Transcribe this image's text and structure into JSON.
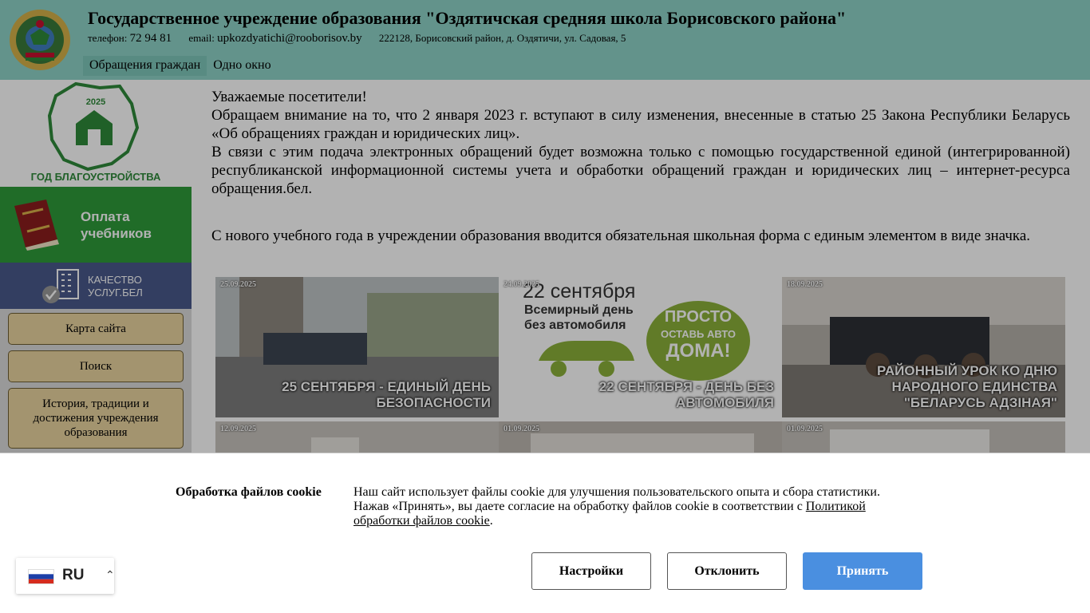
{
  "header": {
    "school_name": "Государственное учреждение образования \"Оздятичская средняя школа Борисовского района\"",
    "phone_label": "телефон:",
    "phone": "72 94 81",
    "email_label": "email:",
    "email": "upkozdyatichi@rooborisov.by",
    "address": "222128, Борисовский район, д. Оздятичи, ул. Садовая, 5",
    "nav": [
      {
        "label": "Обращения граждан"
      },
      {
        "label": "Одно окно"
      }
    ]
  },
  "sidebar": {
    "year_logo": {
      "year": "2025",
      "caption": "ГОД БЛАГОУСТРОЙСТВА"
    },
    "pay_label": "Оплата учебников",
    "quality_line1": "КАЧЕСТВО",
    "quality_line2": "УСЛУГ.БЕЛ",
    "menu": [
      {
        "label": "Карта сайта"
      },
      {
        "label": "Поиск"
      },
      {
        "label": "История, традиции и достижения учреждения образования"
      }
    ]
  },
  "main": {
    "notice": {
      "greeting": "Уважаемые посетители!",
      "p1": "Обращаем внимание на то, что 2 января 2023 г. вступают в силу изменения, внесенные в статью 25 Закона Республики Беларусь «Об обращениях граждан и юридических лиц».",
      "p2": "В связи с этим подача электронных обращений будет возможна только с помощью государственной единой (интегрированной) республиканской информационной системы учета и обработки обращений граждан и юридических лиц – интернет-ресурса обращения.бел.",
      "p3": "С нового учебного года в учреждении образования вводится обязательная школьная форма с единым элементом в виде значка."
    },
    "news": [
      {
        "date": "25.09.2025",
        "title": "25 СЕНТЯБРЯ - ЕДИНЫЙ ДЕНЬ БЕЗОПАСНОСТИ"
      },
      {
        "date": "24.09.2025",
        "title": "22 СЕНТЯБРЯ - ДЕНЬ БЕЗ АВТОМОБИЛЯ",
        "poster": {
          "line1": "22 сентября",
          "line2": "Всемирный день",
          "line3": "без автомобиля",
          "cloud1": "ПРОСТО",
          "cloud2": "ОСТАВЬ АВТО",
          "cloud3": "ДОМА!"
        }
      },
      {
        "date": "18.09.2025",
        "title": "РАЙОННЫЙ УРОК КО ДНЮ НАРОДНОГО ЕДИНСТВА \"БЕЛАРУСЬ АДЗІНАЯ\""
      },
      {
        "date": "12.09.2025",
        "title": ""
      },
      {
        "date": "01.09.2025",
        "title": ""
      },
      {
        "date": "01.09.2025",
        "title": ""
      }
    ]
  },
  "cookie": {
    "title": "Обработка файлов cookie",
    "text_before": "Наш сайт использует файлы cookie для улучшения пользовательского опыта и сбора статистики. Нажав «Принять», вы даете согласие на обработку файлов cookie в соответствии с ",
    "link": "Политикой обработки файлов cookie",
    "text_after": ".",
    "settings_label": "Настройки",
    "reject_label": "Отклонить",
    "accept_label": "Принять"
  },
  "language": {
    "code": "RU",
    "flag": "russia-flag-icon"
  },
  "colors": {
    "header_bg": "#8fd3c7",
    "pay_bg": "#2e9b3a",
    "quality_bg": "#4a5a8c",
    "menu_btn_bg": "#ead5a0",
    "accept_bg": "#4a8fe0"
  }
}
